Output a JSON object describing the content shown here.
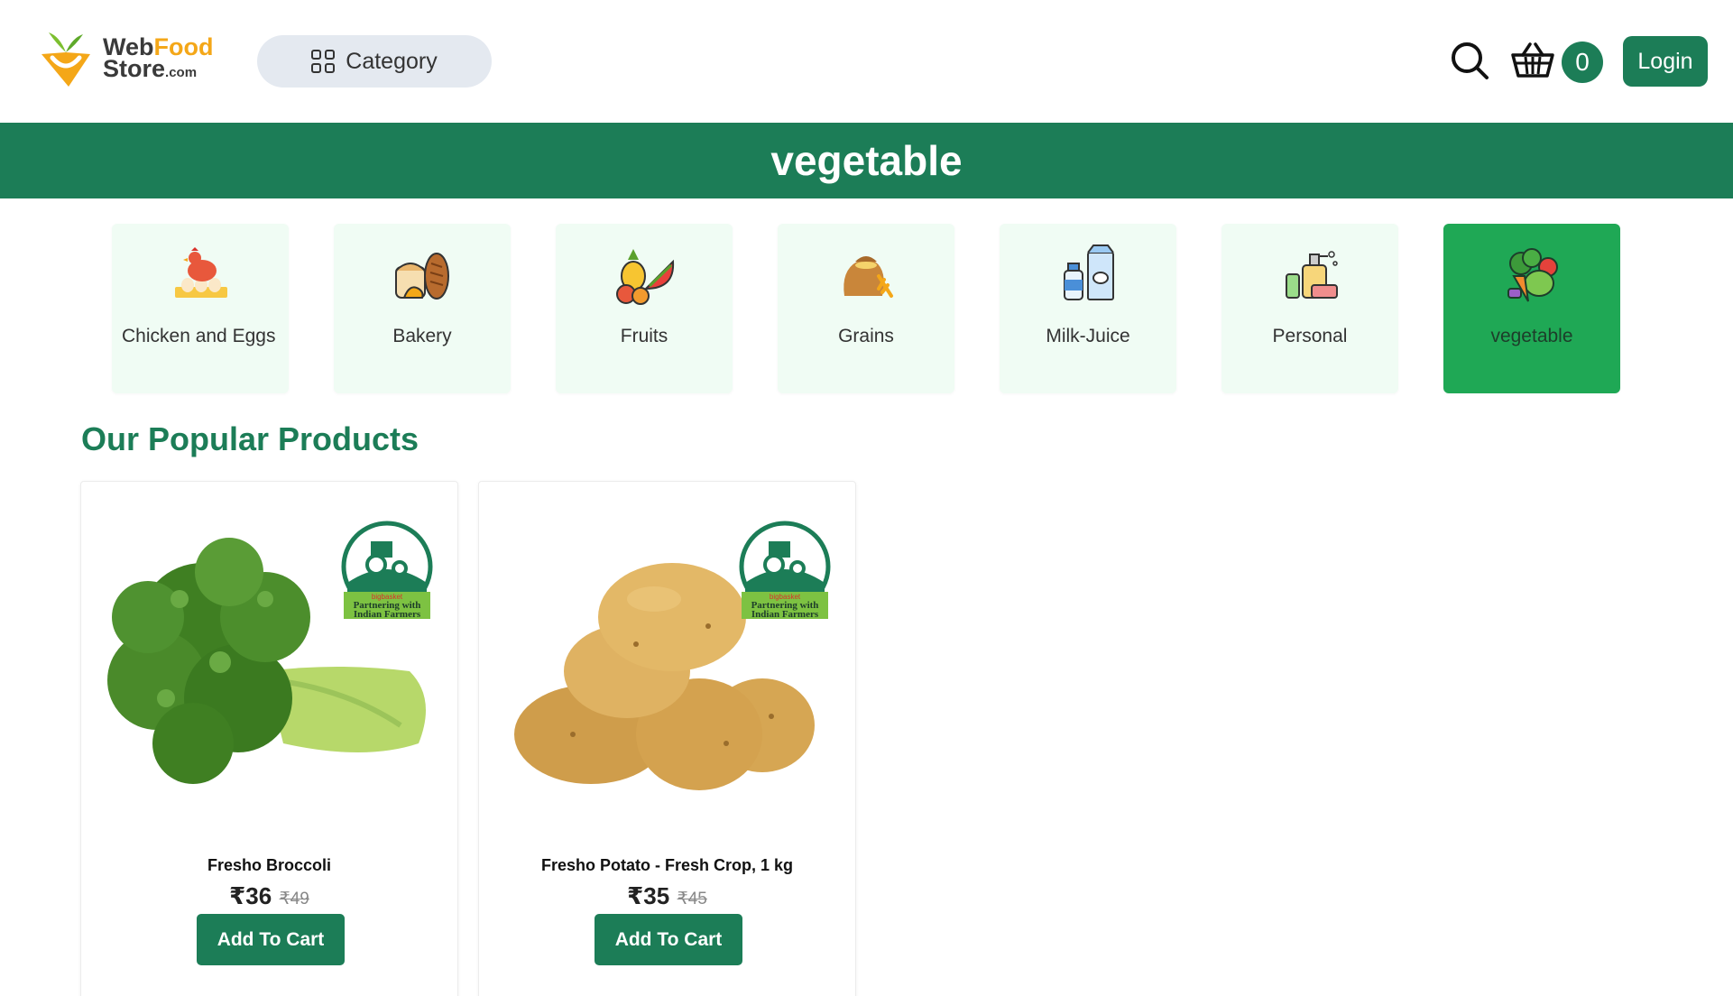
{
  "header": {
    "logo_web": "Web",
    "logo_food": "Food",
    "logo_store": "Store",
    "logo_com": ".com",
    "category_label": "Category",
    "cart_count": "0",
    "login_label": "Login"
  },
  "banner": {
    "title": "vegetable"
  },
  "categories": [
    {
      "label": "Chicken and Eggs",
      "icon": "chicken-eggs-icon"
    },
    {
      "label": "Bakery",
      "icon": "bread-icon"
    },
    {
      "label": "Fruits",
      "icon": "fruits-icon"
    },
    {
      "label": "Grains",
      "icon": "grains-icon"
    },
    {
      "label": "Milk-Juice",
      "icon": "milk-juice-icon"
    },
    {
      "label": "Personal",
      "icon": "personal-care-icon"
    },
    {
      "label": "vegetable",
      "icon": "vegetable-icon",
      "active": true
    }
  ],
  "section": {
    "title": "Our Popular Products"
  },
  "products": [
    {
      "name": "Fresho Broccoli",
      "price": "₹36",
      "mrp": "₹49",
      "button": "Add To Cart",
      "badge_top": "bigbasket",
      "badge_line1": "Partnering with",
      "badge_line2": "Indian Farmers"
    },
    {
      "name": "Fresho Potato - Fresh Crop, 1 kg",
      "price": "₹35",
      "mrp": "₹45",
      "button": "Add To Cart",
      "badge_top": "bigbasket",
      "badge_line1": "Partnering with",
      "badge_line2": "Indian Farmers"
    }
  ],
  "colors": {
    "brand_green": "#1c7d57",
    "active_green": "#1fa855",
    "card_bg": "#f0fcf4",
    "logo_orange": "#f4a718"
  }
}
